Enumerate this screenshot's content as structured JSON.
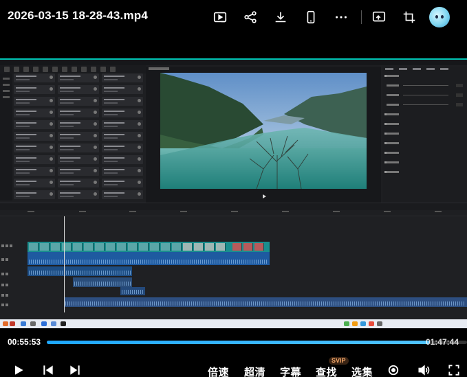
{
  "player": {
    "title": "2026-03-15 18-28-43.mp4",
    "current_time": "00:55:53",
    "total_time": "01:47:44",
    "progress": 0.91
  },
  "top_icons": [
    "picture-in-picture-icon",
    "share-icon",
    "download-icon",
    "phone-icon",
    "more-icon",
    "screen-cast-icon",
    "crop-icon",
    "mascot-avatar"
  ],
  "controls": {
    "speed_label": "倍速",
    "quality_label": "超清",
    "subtitle_label": "字幕",
    "search_label": "查找",
    "search_badge": "SVIP",
    "episodes_label": "选集"
  },
  "colors": {
    "accent": "#1ea7ff",
    "video_clip": "#1a8e8e",
    "audio_clip": "#1e5aa0",
    "badge_bg": "#3a2414",
    "badge_fg": "#f5a86a"
  }
}
